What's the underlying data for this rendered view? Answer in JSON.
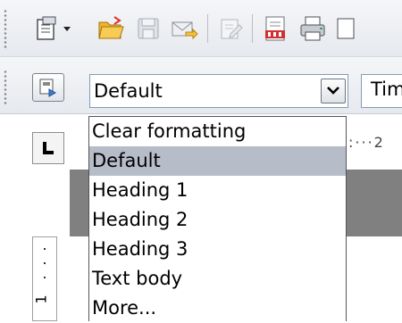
{
  "toolbar_standard": {
    "icons": [
      "new-document-icon",
      "dropdown-arrow-icon",
      "open-folder-icon",
      "save-icon",
      "email-document-icon",
      "edit-file-icon",
      "export-pdf-icon",
      "print-icon"
    ]
  },
  "toolbar_format": {
    "styles_icon": "styles-formatting-icon",
    "style_value": "Default",
    "font_value": "Tim"
  },
  "style_list": {
    "items": [
      "Clear formatting",
      "Default",
      "Heading 1",
      "Heading 2",
      "Heading 3",
      "Text body",
      "More..."
    ],
    "selected": "Default"
  },
  "ruler": {
    "horizontal_snippet": ":···2",
    "vertical_number": "1"
  },
  "colors": {
    "selection": "#b7bcc9",
    "document_background": "#808080"
  }
}
